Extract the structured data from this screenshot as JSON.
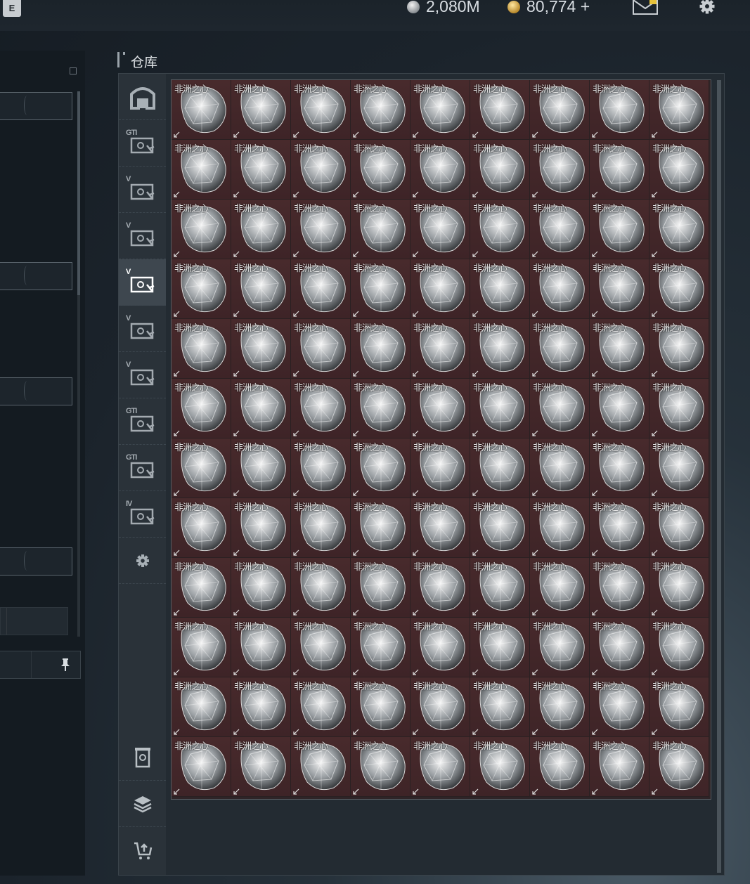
{
  "topbar": {
    "key_hint": "E",
    "currency_silver": "2,080M",
    "currency_gold": "80,774 +",
    "icons": [
      "silver-coin-icon",
      "gold-coin-icon",
      "mail-icon",
      "settings-gear-icon"
    ]
  },
  "warehouse": {
    "title": "仓库",
    "tabs": [
      {
        "label": "",
        "icon": "warehouse-home-icon"
      },
      {
        "label": "GTI",
        "icon": "gti-case-icon"
      },
      {
        "label": "V",
        "icon": "v-case-icon"
      },
      {
        "label": "V",
        "icon": "v-case-icon"
      },
      {
        "label": "V",
        "icon": "v-case-icon",
        "active": true
      },
      {
        "label": "V",
        "icon": "v-case-icon"
      },
      {
        "label": "V",
        "icon": "v-case-icon"
      },
      {
        "label": "GTI",
        "icon": "gti-case-icon"
      },
      {
        "label": "GTI",
        "icon": "gti-case-icon"
      },
      {
        "label": "IV",
        "icon": "iv-case-icon"
      },
      {
        "label": "",
        "icon": "settings-gear-icon"
      }
    ],
    "bottom_tools": [
      "trash-can-icon",
      "layers-icon",
      "sort-cart-icon"
    ],
    "grid": {
      "rows": 12,
      "cols": 9,
      "item_name": "非洲之心",
      "item_icon": "diamond-gem-icon"
    }
  },
  "colors": {
    "cell_bg": "#45292b",
    "active_tab": "#3e474f",
    "panel": "#2a3239"
  }
}
